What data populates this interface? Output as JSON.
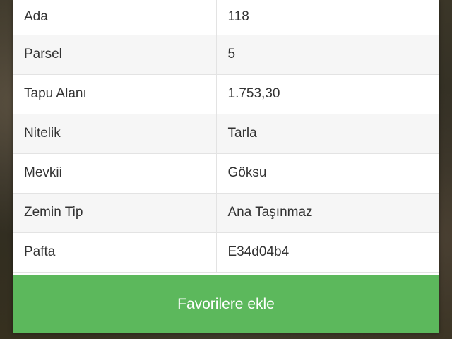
{
  "details": {
    "rows": [
      {
        "label": "Ada",
        "value": "118"
      },
      {
        "label": "Parsel",
        "value": "5"
      },
      {
        "label": "Tapu Alanı",
        "value": "1.753,30"
      },
      {
        "label": "Nitelik",
        "value": "Tarla"
      },
      {
        "label": "Mevkii",
        "value": "Göksu"
      },
      {
        "label": "Zemin Tip",
        "value": "Ana Taşınmaz"
      },
      {
        "label": "Pafta",
        "value": "E34d04b4"
      }
    ]
  },
  "actions": {
    "favorite_label": "Favorilere ekle"
  },
  "colors": {
    "button": "#5cb85c",
    "row_alt": "#f6f6f6",
    "text": "#333333"
  }
}
